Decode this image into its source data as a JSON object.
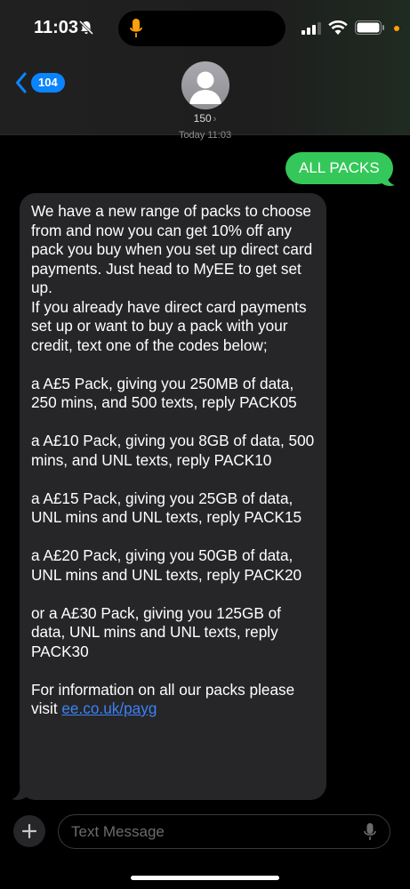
{
  "status_bar": {
    "time": "11:03"
  },
  "header": {
    "back_count": "104",
    "contact_name": "150",
    "contact_chevron": "›",
    "timestamp": "Today 11:03"
  },
  "messages": {
    "sent": "ALL PACKS",
    "received": {
      "p1": "We have a new range of packs to choose from and now you can get 10% off any pack you buy when you set up direct card payments. Just head to MyEE to get set up.",
      "p2": "If you already have direct card payments set up or want to buy a pack with your credit, text one of the codes below;",
      "p3": "a A£5 Pack, giving you 250MB of data, 250 mins, and 500 texts, reply PACK05",
      "p4": "a A£10 Pack, giving you 8GB of data, 500 mins, and UNL texts, reply PACK10",
      "p5": "a A£15 Pack, giving you 25GB of data, UNL mins and UNL texts, reply PACK15",
      "p6": "a A£20 Pack, giving you 50GB of data, UNL mins and UNL texts, reply PACK20",
      "p7": "or a A£30 Pack, giving you 125GB of data, UNL mins and UNL texts, reply PACK30",
      "p8_text": "For information on all our packs please visit ",
      "p8_link": "ee.co.uk/payg"
    }
  },
  "composer": {
    "placeholder": "Text Message"
  },
  "colors": {
    "sent_bubble": "#34c759",
    "received_bubble": "#262628",
    "accent": "#0a84ff",
    "link": "#3b82f6"
  },
  "icons": [
    "bell-off-icon",
    "microphone-icon",
    "signal-icon",
    "wifi-icon",
    "battery-icon",
    "back-chevron-icon",
    "contact-avatar-icon",
    "plus-icon"
  ]
}
